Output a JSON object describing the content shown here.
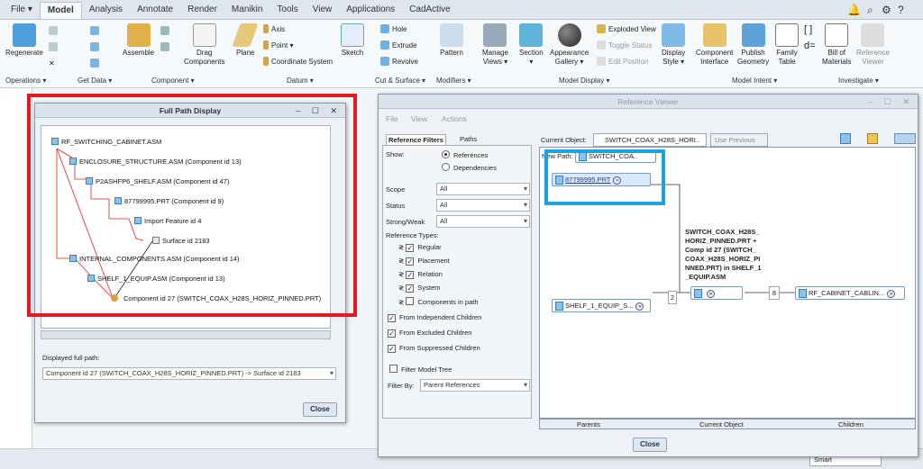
{
  "tabs": [
    "File ▾",
    "Model",
    "Analysis",
    "Annotate",
    "Render",
    "Manikin",
    "Tools",
    "View",
    "Applications",
    "CadActive"
  ],
  "ribbon": {
    "regenerate": "Regenerate",
    "assemble": "Assemble",
    "drag_components": "Drag\nComponents",
    "plane": "Plane",
    "axis": "Axis",
    "point": "Point ▾",
    "coordinate_system": "Coordinate System",
    "sketch": "Sketch",
    "hole": "Hole",
    "extrude": "Extrude",
    "revolve": "Revolve",
    "pattern": "Pattern",
    "manage_views": "Manage\nViews ▾",
    "section": "Section\n▾",
    "appearance_gallery": "Appearance\nGallery ▾",
    "exploded_view": "Exploded View",
    "toggle_status": "Toggle Status",
    "edit_position": "Edit Position",
    "display_style": "Display\nStyle ▾",
    "component_interface": "Component\nInterface",
    "publish_geometry": "Publish\nGeometry",
    "family_table": "Family\nTable",
    "bill_of_materials": "Bill of\nMaterials",
    "reference_viewer": "Reference\nViewer",
    "groups": [
      "Operations ▾",
      "Get Data ▾",
      "Component ▾",
      "Datum ▾",
      "Cut & Surface ▾",
      "Modifiers ▾",
      "Model Display ▾",
      "Model Intent ▾",
      "Investigate ▾"
    ]
  },
  "full_path": {
    "title": "Full Path Display",
    "nodes": [
      "RF_SWITCHING_CABINET.ASM",
      "ENCLOSURE_STRUCTURE.ASM (Component id 13)",
      "P2ASHFP6_SHELF.ASM (Component id 47)",
      "87799995.PRT (Component id 9)",
      "Import Feature id 4",
      "Surface id 2183",
      "INTERNAL_COMPONENTS.ASM (Component id 14)",
      "SHELF_1_EQUIP.ASM (Component id 13)",
      "Component id 27 (SWITCH_COAX_H28S_HORIZ_PINNED.PRT)"
    ],
    "displayed_label": "Displayed full path:",
    "displayed_value": "Component id 27 (SWITCH_COAX_H28S_HORIZ_PINNED.PRT) -> Surface id 2183",
    "close": "Close"
  },
  "ref_viewer": {
    "title": "Reference Viewer",
    "menu": [
      "File",
      "View",
      "Actions"
    ],
    "tabs": [
      "Reference Filters",
      "Paths"
    ],
    "show_label": "Show:",
    "show_options": [
      "References",
      "Dependencies"
    ],
    "scope": {
      "label": "Scope",
      "value": "All"
    },
    "status": {
      "label": "Status",
      "value": "All"
    },
    "strong_weak": {
      "label": "Strong/Weak",
      "value": "All"
    },
    "ref_types_label": "Reference Types:",
    "ref_types": [
      "Regular",
      "Placement",
      "Relation",
      "System",
      "Components in path"
    ],
    "children_opts": [
      "From Independent Children",
      "From Excluded Children",
      "From Suppressed Children"
    ],
    "filter_tree": "Filter Model Tree",
    "filter_by_label": "Filter By:",
    "filter_by_value": "Parent References",
    "current_object_label": "Current Object:",
    "current_object_value": "SWITCH_COAX_H28S_HORI..",
    "use_previous": "Use Previous",
    "new_path": "New Path:",
    "new_path_chip": "SWITCH_COA..",
    "chip_prt": "87799995.PRT",
    "chip_shelf": "SHELF_1_EQUIP_S...",
    "chip_cabinet": "RF_CABINET_CABLIN...",
    "count_2": "2",
    "count_8": "8",
    "note": "SWITCH_COAX_H28S_\nHORIZ_PINNED.PRT +\nComp id 27 (SWITCH_\nCOAX_H28S_HORIZ_PI\nNNED.PRT) in SHELF_1\n_EQUIP.ASM",
    "columns": [
      "Parents",
      "Current Object",
      "Children"
    ],
    "close": "Close"
  },
  "status": {
    "smart": "Smart"
  }
}
